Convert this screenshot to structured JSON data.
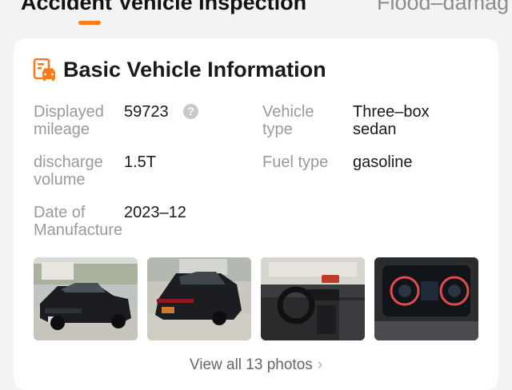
{
  "tabs": {
    "active": "Accident Vehicle Inspection",
    "inactive": "Flood–damag"
  },
  "card": {
    "title": "Basic Vehicle Information",
    "icon": "car-document-icon",
    "fields": {
      "mileage": {
        "label_1": "Displayed",
        "label_2": "mileage",
        "value": "59723",
        "help_icon": "?"
      },
      "vehicle_type": {
        "label_1": "Vehicle",
        "label_2": "type",
        "value_1": "Three–box",
        "value_2": "sedan"
      },
      "discharge": {
        "label_1": "discharge",
        "label_2": "volume",
        "value": "1.5T"
      },
      "fuel": {
        "label": "Fuel type",
        "value": "gasoline"
      },
      "manufacture": {
        "label_1": "Date of",
        "label_2": "Manufacture",
        "value": "2023–12"
      }
    },
    "photos": [
      {
        "description": "car-front-exterior"
      },
      {
        "description": "car-rear-exterior"
      },
      {
        "description": "car-interior-dashboard"
      },
      {
        "description": "instrument-cluster"
      }
    ],
    "view_all": "View all 13 photos"
  },
  "colors": {
    "accent": "#ff7a1a",
    "label": "#9a9a9a",
    "text": "#1a1a1a",
    "background": "#f3f3f5"
  }
}
